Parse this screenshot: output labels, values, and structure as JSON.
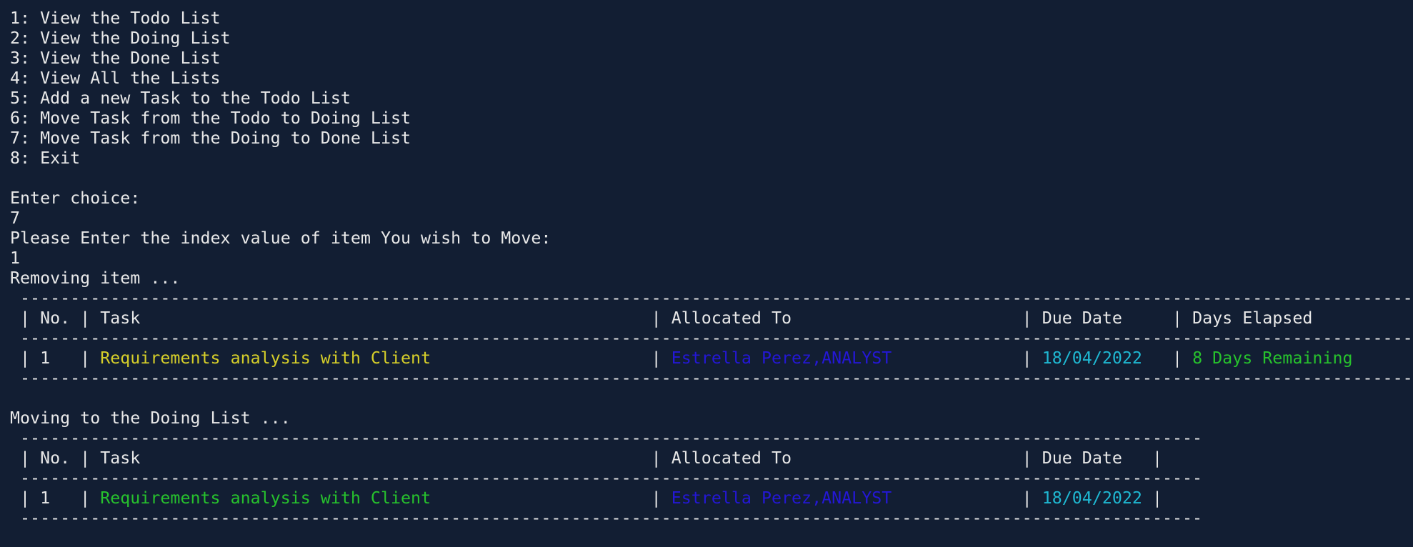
{
  "menu": [
    "1: View the Todo List",
    "2: View the Doing List",
    "3: View the Done List",
    "4: View All the Lists",
    "5: Add a new Task to the Todo List",
    "6: Move Task from the Todo to Doing List",
    "7: Move Task from the Doing to Done List",
    "8: Exit"
  ],
  "prompt_choice": "Enter choice:",
  "choice_value": "7",
  "prompt_index": "Please Enter the index value of item You wish to Move:",
  "index_value": "1",
  "removing_msg": "Removing item ...",
  "table1": {
    "rule": " ----------------------------------------------------------------------------------------------------------------------------------------------",
    "header": {
      "no": " | No. | ",
      "task": "Task                                                  ",
      "alloc_sep": " | ",
      "allocated": "Allocated To                      ",
      "due_sep": " | ",
      "due": "Due Date    ",
      "days_sep": " | ",
      "days": "Days Elapsed         ",
      "end": " |"
    },
    "row": {
      "no": " | 1   | ",
      "task": "Requirements analysis with Client                     ",
      "alloc_sep": " | ",
      "allocated": "Estrella Perez,ANALYST            ",
      "due_sep": " | ",
      "due": "18/04/2022  ",
      "days_sep": " | ",
      "days": "8 Days Remaining     ",
      "end": " |"
    }
  },
  "moving_msg": "Moving to the Doing List ...",
  "table2": {
    "rule": " ----------------------------------------------------------------------------------------------------------------------",
    "header": {
      "no": " | No. | ",
      "task": "Task                                                  ",
      "alloc_sep": " | ",
      "allocated": "Allocated To                      ",
      "due_sep": " | ",
      "due": "Due Date  ",
      "end": " |"
    },
    "row": {
      "no": " | 1   | ",
      "task": "Requirements analysis with Client                     ",
      "alloc_sep": " | ",
      "allocated": "Estrella Perez,ANALYST            ",
      "due_sep": " | ",
      "due": "18/04/2022",
      "end": " |"
    }
  },
  "colors": {
    "background": "#121e33",
    "text": "#e8e8e8",
    "task_todo": "#d6cf2a",
    "task_doing": "#27c22d",
    "allocated": "#2417d6",
    "due_date": "#1fb8d2",
    "days_remaining": "#27c22d"
  }
}
